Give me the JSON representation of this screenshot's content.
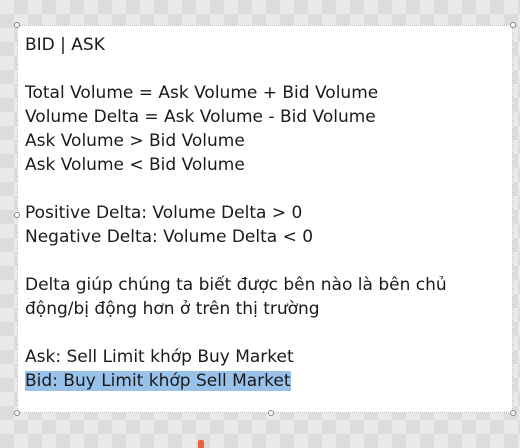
{
  "document": {
    "heading": "BID | ASK",
    "formulas": [
      "Total Volume = Ask Volume + Bid Volume",
      "Volume Delta = Ask Volume - Bid Volume",
      "Ask Volume > Bid Volume",
      "Ask Volume < Bid Volume"
    ],
    "deltas": [
      "Positive Delta: Volume Delta > 0",
      "Negative Delta: Volume Delta < 0"
    ],
    "explanation": "Delta giúp chúng ta biết được bên nào là bên chủ động/bị động hơn ở trên thị trường",
    "ask_line": "Ask: Sell Limit khớp Buy Market",
    "bid_line_selected": "Bid: Buy Limit khớp Sell Market"
  },
  "colors": {
    "selection": "#99c2ea",
    "text": "#1a1a1a",
    "canvas": "#ffffff"
  }
}
